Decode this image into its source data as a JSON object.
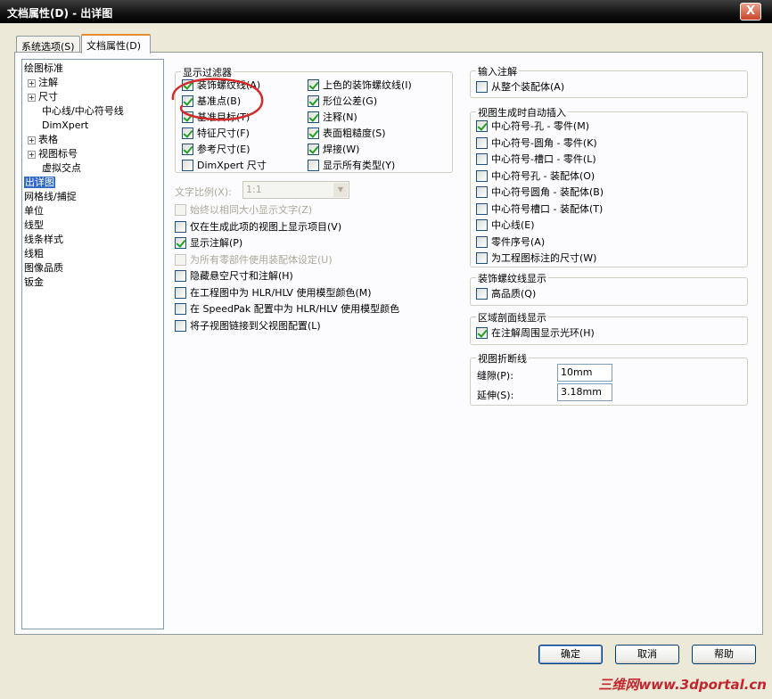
{
  "window": {
    "title": "文档属性(D) - 出详图",
    "close": "X"
  },
  "tabs": [
    {
      "label": "系统选项(S)"
    },
    {
      "label": "文档属性(D)"
    }
  ],
  "tree": [
    {
      "label": "绘图标准",
      "level": 0,
      "expand": false
    },
    {
      "label": "注解",
      "level": 1,
      "expand": true
    },
    {
      "label": "尺寸",
      "level": 1,
      "expand": true
    },
    {
      "label": "中心线/中心符号线",
      "level": 2,
      "expand": false
    },
    {
      "label": "DimXpert",
      "level": 2,
      "expand": false
    },
    {
      "label": "表格",
      "level": 1,
      "expand": true
    },
    {
      "label": "视图标号",
      "level": 1,
      "expand": true
    },
    {
      "label": "虚拟交点",
      "level": 2,
      "expand": false
    },
    {
      "label": "出详图",
      "level": 0,
      "expand": false,
      "selected": true
    },
    {
      "label": "网格线/捕捉",
      "level": 0,
      "expand": false
    },
    {
      "label": "单位",
      "level": 0,
      "expand": false
    },
    {
      "label": "线型",
      "level": 0,
      "expand": false
    },
    {
      "label": "线条样式",
      "level": 0,
      "expand": false
    },
    {
      "label": "线粗",
      "level": 0,
      "expand": false
    },
    {
      "label": "图像品质",
      "level": 0,
      "expand": false
    },
    {
      "label": "钣金",
      "level": 0,
      "expand": false
    }
  ],
  "display_filter": {
    "title": "显示过滤器",
    "left": [
      {
        "label": "装饰螺纹线(A)",
        "checked": true
      },
      {
        "label": "基准点(B)",
        "checked": true
      },
      {
        "label": "基准目标(T)",
        "checked": true
      },
      {
        "label": "特征尺寸(F)",
        "checked": true
      },
      {
        "label": "参考尺寸(E)",
        "checked": true
      },
      {
        "label": "DimXpert 尺寸",
        "checked": false
      }
    ],
    "right": [
      {
        "label": "上色的装饰螺纹线(I)",
        "checked": true
      },
      {
        "label": "形位公差(G)",
        "checked": true
      },
      {
        "label": "注释(N)",
        "checked": true
      },
      {
        "label": "表面粗糙度(S)",
        "checked": true
      },
      {
        "label": "焊接(W)",
        "checked": true
      },
      {
        "label": "显示所有类型(Y)",
        "checked": false
      }
    ]
  },
  "text_scale": {
    "label": "文字比例(X):",
    "value": "1:1"
  },
  "options": [
    {
      "label": "始终以相同大小显示文字(Z)",
      "checked": false,
      "disabled": true
    },
    {
      "label": "仅在生成此项的视图上显示项目(V)",
      "checked": false,
      "disabled": false
    },
    {
      "label": "显示注解(P)",
      "checked": true,
      "disabled": false
    },
    {
      "label": "为所有零部件使用装配体设定(U)",
      "checked": false,
      "disabled": true
    },
    {
      "label": "隐藏悬空尺寸和注解(H)",
      "checked": false,
      "disabled": false
    },
    {
      "label": "在工程图中为 HLR/HLV 使用模型颜色(M)",
      "checked": false,
      "disabled": false
    },
    {
      "label": "在 SpeedPak 配置中为 HLR/HLV 使用模型颜色",
      "checked": false,
      "disabled": false
    },
    {
      "label": "将子视图链接到父视图配置(L)",
      "checked": false,
      "disabled": false
    }
  ],
  "import_annotations": {
    "title": "输入注解",
    "items": [
      {
        "label": "从整个装配体(A)",
        "checked": false
      }
    ]
  },
  "auto_insert": {
    "title": "视图生成时自动插入",
    "items": [
      {
        "label": "中心符号-孔 - 零件(M)",
        "checked": true
      },
      {
        "label": "中心符号-圆角 - 零件(K)",
        "checked": false
      },
      {
        "label": "中心符号-槽口 - 零件(L)",
        "checked": false
      },
      {
        "label": "中心符号孔 - 装配体(O)",
        "checked": false
      },
      {
        "label": "中心符号圆角 - 装配体(B)",
        "checked": false
      },
      {
        "label": "中心符号槽口 - 装配体(T)",
        "checked": false
      },
      {
        "label": "中心线(E)",
        "checked": false
      },
      {
        "label": "零件序号(A)",
        "checked": false
      },
      {
        "label": "为工程图标注的尺寸(W)",
        "checked": false
      }
    ]
  },
  "cosmetic_thread": {
    "title": "装饰螺纹线显示",
    "items": [
      {
        "label": "高品质(Q)",
        "checked": false
      }
    ]
  },
  "area_hatch": {
    "title": "区域剖面线显示",
    "items": [
      {
        "label": "在注解周围显示光环(H)",
        "checked": true
      }
    ]
  },
  "break_line": {
    "title": "视图折断线",
    "gap_label": "缝隙(P):",
    "gap_value": "10mm",
    "extension_label": "延伸(S):",
    "extension_value": "3.18mm"
  },
  "buttons": {
    "ok": "确定",
    "cancel": "取消",
    "help": "帮助"
  },
  "watermark": "三维网www.3dportal.cn"
}
